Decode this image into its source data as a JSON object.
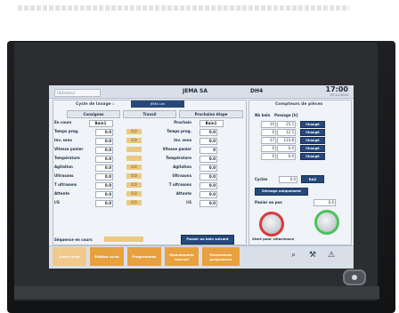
{
  "header": {
    "field_placeholder": "Utilisateur",
    "app_title": "JEMA SA",
    "machine": "DH4",
    "time": "17:00",
    "date": "07.12.2020"
  },
  "left_panel": {
    "cycle_label": "Cycle de lavage :",
    "cycle_value": "JEMA Lan",
    "tabs": [
      "Consignes",
      "Travail",
      "Prochaine étape"
    ],
    "rows": [
      {
        "label": "En cours",
        "value": "Bain1",
        "value2": "",
        "label2": "Prochain",
        "value3": "Bain1"
      },
      {
        "label": "Temps prog.",
        "value": "0.0",
        "value2": "0.0",
        "label2": "Temps prog.",
        "value3": "0.0"
      },
      {
        "label": "Inv. sens",
        "value": "0.0",
        "value2": "0.0",
        "label2": "Inv. sens",
        "value3": "0.0"
      },
      {
        "label": "Vitesse panier",
        "value": "0.0",
        "value2": "",
        "label2": "Vitesse panier",
        "value3": "0"
      },
      {
        "label": "Température",
        "value": "0.0",
        "value2": "",
        "label2": "Température",
        "value3": "0.0"
      },
      {
        "label": "Agitation",
        "value": "0.0",
        "value2": "0.0",
        "label2": "Agitation",
        "value3": "0.0"
      },
      {
        "label": "Ultrasons",
        "value": "0.0",
        "value2": "0.0",
        "label2": "Ultrasons",
        "value3": "0.0"
      },
      {
        "label": "T ultrasons",
        "value": "0.0",
        "value2": "0.0",
        "label2": "T ultrasons",
        "value3": "0.0"
      },
      {
        "label": "Attente",
        "value": "0.0",
        "value2": "0.0",
        "label2": "Attente",
        "value3": "0.0"
      },
      {
        "label": "I/S",
        "value": "0.0",
        "value2": "0.0",
        "label2": "I/S",
        "value3": "0.0"
      }
    ],
    "sequence_label": "Séquence en cours",
    "next_button": "Passer au bain suivant"
  },
  "right_panel": {
    "title": "Compteurs de pièces",
    "col_bain": "Nb bain",
    "col_passage": "Passage [h]",
    "rows": [
      {
        "nb": "10",
        "passage": "25.5",
        "button": "Changé"
      },
      {
        "nb": "0",
        "passage": "12.5",
        "button": "Changé"
      },
      {
        "nb": "37",
        "passage": "123.8",
        "button": "Changé"
      },
      {
        "nb": "0",
        "passage": "0.0",
        "button": "Changé"
      },
      {
        "nb": "0",
        "passage": "0.0",
        "button": "Changé"
      }
    ],
    "cycles_label": "Cycles",
    "cycles_value": "0.0",
    "raz_button": "RAZ",
    "sechage_button": "Séchage uniquement",
    "panier_label": "Panier en pos",
    "panier_value": "0.0",
    "start_label": "Start pour vélocimace"
  },
  "bottom": {
    "buttons": [
      "Suivi cycle",
      "Édition cycle",
      "Programmes",
      "Mouvements manuel",
      "Paramètres programme"
    ],
    "icons": [
      "search-icon",
      "tools-icon",
      "warning-icon"
    ]
  },
  "colors": {
    "accent": "#27497a",
    "amber": "#ecc97f",
    "orange": "#e8a13f",
    "stop": "#d83a3a",
    "go": "#4cc35a"
  }
}
